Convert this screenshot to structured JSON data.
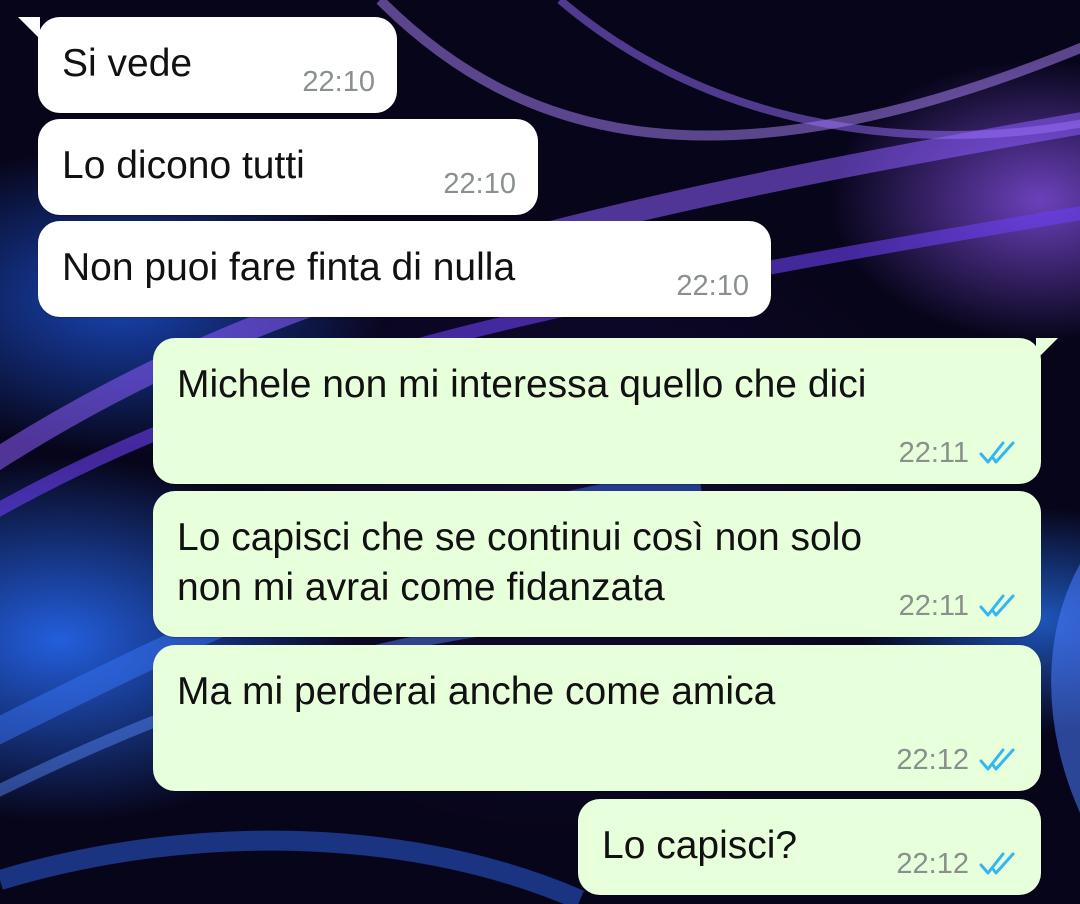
{
  "conversation": {
    "messages": [
      {
        "text": "Si vede",
        "time": "22:10",
        "direction": "incoming"
      },
      {
        "text": "Lo dicono tutti",
        "time": "22:10",
        "direction": "incoming"
      },
      {
        "text": "Non puoi fare finta di nulla",
        "time": "22:10",
        "direction": "incoming"
      },
      {
        "text": "Michele non mi interessa quello che dici",
        "time": "22:11",
        "direction": "outgoing",
        "status": "read"
      },
      {
        "text": "Lo capisci che se continui così non solo\nnon mi avrai come fidanzata",
        "time": "22:11",
        "direction": "outgoing",
        "status": "read"
      },
      {
        "text": "Ma mi perderai anche come amica",
        "time": "22:12",
        "direction": "outgoing",
        "status": "read"
      },
      {
        "text": "Lo capisci?",
        "time": "22:12",
        "direction": "outgoing",
        "status": "read"
      }
    ]
  },
  "icons": {
    "read_receipt": "double-check-icon"
  },
  "colors": {
    "incoming_bubble": "#ffffff",
    "outgoing_bubble": "#e7ffdb",
    "read_tick": "#34b7f1",
    "timestamp": "#8a918d"
  }
}
